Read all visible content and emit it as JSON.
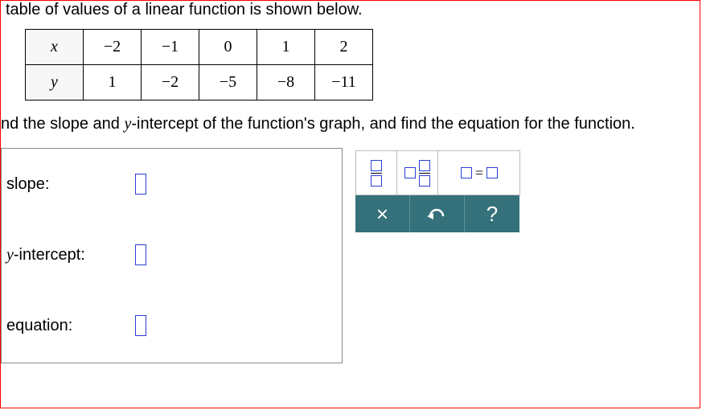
{
  "intro": "table of values of a linear function is shown below.",
  "table": {
    "row_x": {
      "label": "x",
      "values": [
        "−2",
        "−1",
        "0",
        "1",
        "2"
      ]
    },
    "row_y": {
      "label": "y",
      "values": [
        "1",
        "−2",
        "−5",
        "−8",
        "−11"
      ]
    }
  },
  "prompt_prefix": "nd the slope and ",
  "prompt_yvar": "y",
  "prompt_suffix": "-intercept of the function's graph, and find the equation for the function.",
  "answers": {
    "slope_label": "slope:",
    "yint_label_y": "y",
    "yint_label_rest": "-intercept:",
    "equation_label": "equation:"
  },
  "toolbox": {
    "clear_label": "×",
    "help_label": "?"
  },
  "chart_data": {
    "type": "table",
    "title": "Linear function values",
    "columns": [
      "x",
      "y"
    ],
    "rows": [
      {
        "x": -2,
        "y": 1
      },
      {
        "x": -1,
        "y": -2
      },
      {
        "x": 0,
        "y": -5
      },
      {
        "x": 1,
        "y": -8
      },
      {
        "x": 2,
        "y": -11
      }
    ]
  }
}
